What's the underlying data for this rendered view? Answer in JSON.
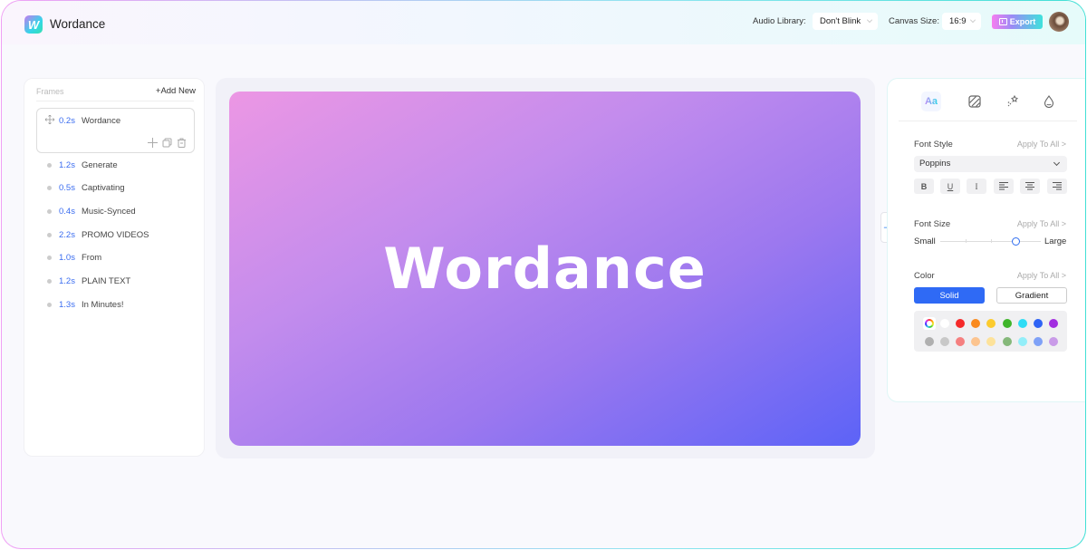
{
  "app": {
    "title": "Wordance",
    "logo_letter": "W"
  },
  "header": {
    "audio_label": "Audio Library:",
    "audio_value": "Don't Blink",
    "canvas_label": "Canvas Size:",
    "canvas_value": "16:9",
    "export_label": "Export"
  },
  "frames": {
    "title": "Frames",
    "add_new": "+Add New",
    "selected": {
      "time": "0.2s",
      "text": "Wordance"
    },
    "items": [
      {
        "time": "1.2s",
        "text": "Generate"
      },
      {
        "time": "0.5s",
        "text": "Captivating"
      },
      {
        "time": "0.4s",
        "text": "Music-Synced"
      },
      {
        "time": "2.2s",
        "text": "PROMO VIDEOS"
      },
      {
        "time": "1.0s",
        "text": "From"
      },
      {
        "time": "1.2s",
        "text": "PLAIN TEXT"
      },
      {
        "time": "1.3s",
        "text": "In Minutes!"
      }
    ]
  },
  "canvas": {
    "text": "Wordance",
    "gradient": [
      "#ec97e4",
      "#5c63f7"
    ]
  },
  "props": {
    "tools": [
      "text-style",
      "background",
      "effects",
      "color-drop"
    ],
    "font_style": {
      "label": "Font Style",
      "apply": "Apply To All >",
      "font": "Poppins",
      "format_buttons": [
        "B",
        "U",
        "I",
        "align-left",
        "align-center",
        "align-right"
      ]
    },
    "font_size": {
      "label": "Font Size",
      "apply": "Apply To All >",
      "min_label": "Small",
      "max_label": "Large",
      "value_fraction": 0.75
    },
    "color": {
      "label": "Color",
      "apply": "Apply To All >",
      "solid": "Solid",
      "gradient": "Gradient",
      "row1": [
        "picker",
        "#ffffff",
        "#f52a2a",
        "#fa8a1e",
        "#fccb2e",
        "#3fb52a",
        "#2fdcf5",
        "#2f64f5",
        "#a22ee0"
      ],
      "row2": [
        "#b0b0b0",
        "#c8c8c8",
        "#f58080",
        "#fcc48f",
        "#fde29a",
        "#85b87a",
        "#93eef9",
        "#7fa1f7",
        "#c99be8"
      ]
    }
  },
  "accent": "#2f6af5"
}
